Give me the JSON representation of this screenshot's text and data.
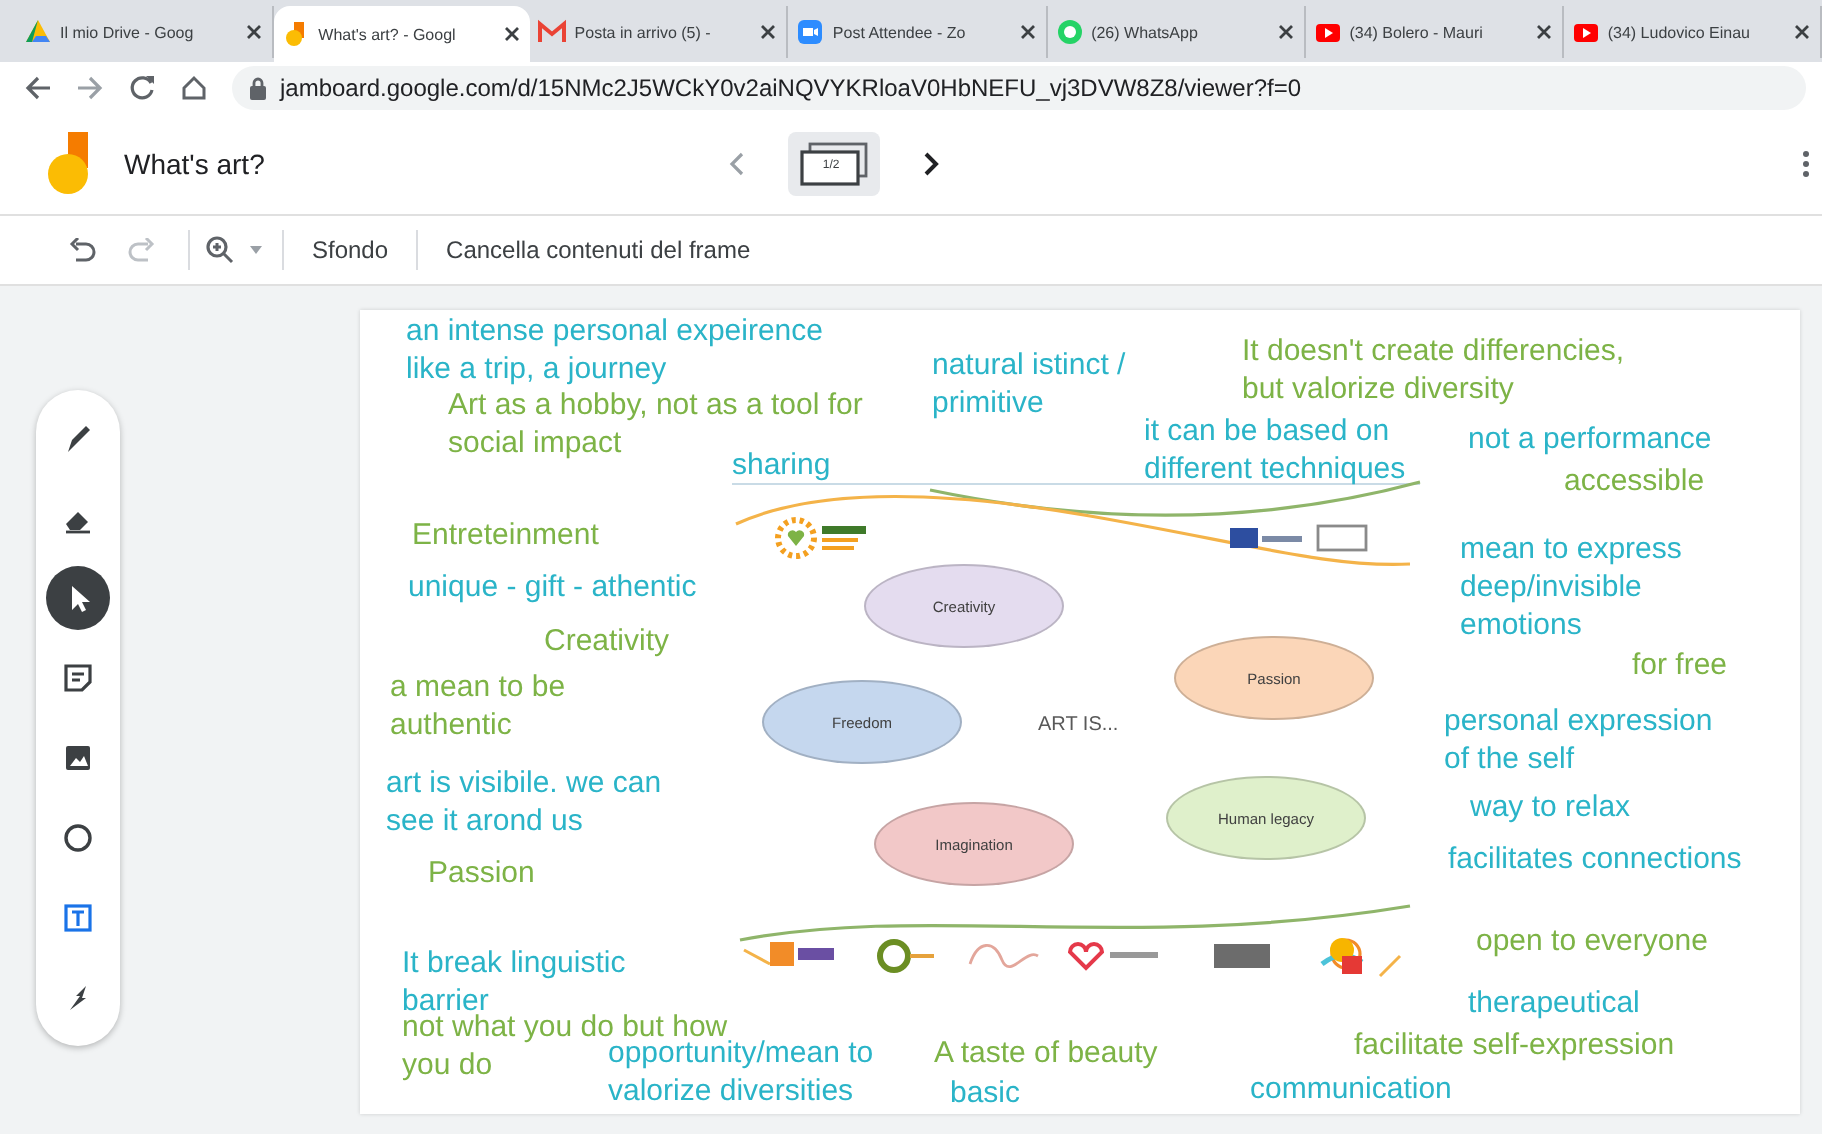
{
  "browser": {
    "tabs": [
      {
        "title": "Il mio Drive - Goog",
        "selected": false
      },
      {
        "title": "What's art? - Googl",
        "selected": true
      },
      {
        "title": "Posta in arrivo (5) -",
        "selected": false
      },
      {
        "title": "Post Attendee - Zo",
        "selected": false
      },
      {
        "title": "(26) WhatsApp",
        "selected": false
      },
      {
        "title": "(34) Bolero - Mauri",
        "selected": false
      },
      {
        "title": "(34) Ludovico Einau",
        "selected": false
      }
    ],
    "address": "jamboard.google.com/d/15NMc2J5WCkY0v2aiNQVYKRloaV0HbNEFU_vj3DVW8Z8/viewer?f=0"
  },
  "app": {
    "title": "What's art?",
    "frame_counter": "1/2"
  },
  "toolbar": {
    "background_button": "Sfondo",
    "clear_button": "Cancella contenuti del frame"
  },
  "tools": [
    {
      "selected": false
    },
    {
      "selected": false
    },
    {
      "selected": true
    },
    {
      "selected": false
    },
    {
      "selected": false
    },
    {
      "selected": false
    },
    {
      "selected": false
    },
    {
      "selected": false
    }
  ],
  "slide": {
    "title": "ART IS...",
    "bubbles": [
      {
        "label": "Creativity",
        "color": "#e4dcef"
      },
      {
        "label": "Passion",
        "color": "#fbd6b8"
      },
      {
        "label": "Freedom",
        "color": "#c5d7ee"
      },
      {
        "label": "Human legacy",
        "color": "#dff0cb"
      },
      {
        "label": "Imagination",
        "color": "#f2c8c8"
      }
    ]
  },
  "notes": [
    {
      "text": "an intense personal expeirence\nlike a trip, a journey",
      "color": "#2ab4c8"
    },
    {
      "text": "Art as a hobby, not as a tool for\nsocial impact",
      "color": "#7db346"
    },
    {
      "text": "natural istinct /\nprimitive",
      "color": "#2ab4c8"
    },
    {
      "text": "It doesn't create differencies,\nbut valorize diversity",
      "color": "#7db346"
    },
    {
      "text": "sharing",
      "color": "#2ab4c8"
    },
    {
      "text": "it can be based on\ndifferent techniques",
      "color": "#2ab4c8"
    },
    {
      "text": "not a performance",
      "color": "#2ab4c8"
    },
    {
      "text": "accessible",
      "color": "#7db346"
    },
    {
      "text": "Entreteinment",
      "color": "#7db346"
    },
    {
      "text": "unique - gift - athentic",
      "color": "#2ab4c8"
    },
    {
      "text": "Creativity",
      "color": "#7db346"
    },
    {
      "text": "a mean to be\nauthentic",
      "color": "#7db346"
    },
    {
      "text": "art is visibile. we can\nsee it arond us",
      "color": "#2ab4c8"
    },
    {
      "text": "Passion",
      "color": "#7db346"
    },
    {
      "text": "mean to express\ndeep/invisible\nemotions",
      "color": "#2ab4c8"
    },
    {
      "text": "for free",
      "color": "#7db346"
    },
    {
      "text": "personal expression\nof the self",
      "color": "#2ab4c8"
    },
    {
      "text": "way to relax",
      "color": "#2ab4c8"
    },
    {
      "text": "facilitates connections",
      "color": "#2ab4c8"
    },
    {
      "text": "open to everyone",
      "color": "#7db346"
    },
    {
      "text": "therapeutical",
      "color": "#2ab4c8"
    },
    {
      "text": "facilitate self-expression",
      "color": "#7db346"
    },
    {
      "text": "communication",
      "color": "#2ab4c8"
    },
    {
      "text": "It break linguistic\nbarrier",
      "color": "#2ab4c8"
    },
    {
      "text": "not what you do but how",
      "color": "#7db346"
    },
    {
      "text": "you do",
      "color": "#7db346"
    },
    {
      "text": "opportunity/mean to\nvalorize diversities",
      "color": "#2ab4c8"
    },
    {
      "text": "A taste of beauty",
      "color": "#7db346"
    },
    {
      "text": "basic",
      "color": "#2ab4c8"
    }
  ]
}
